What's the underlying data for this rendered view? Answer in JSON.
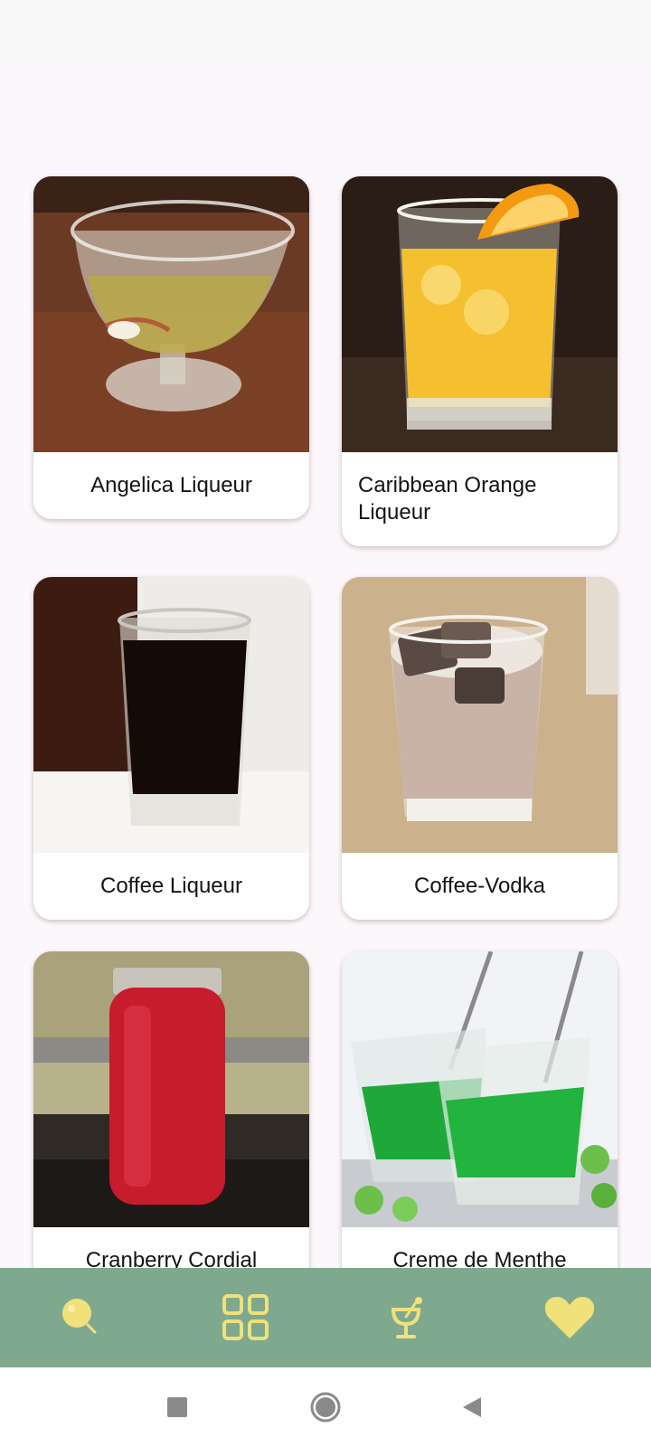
{
  "drinks": [
    {
      "name": "Angelica Liqueur"
    },
    {
      "name": "Caribbean Orange Liqueur"
    },
    {
      "name": "Coffee Liqueur"
    },
    {
      "name": "Coffee-Vodka"
    },
    {
      "name": "Cranberry Cordial"
    },
    {
      "name": "Creme de Menthe"
    }
  ],
  "bottom_nav": {
    "items": [
      {
        "icon": "search-icon"
      },
      {
        "icon": "grid-icon"
      },
      {
        "icon": "cocktail-icon"
      },
      {
        "icon": "heart-icon"
      }
    ],
    "color": "#7ea98f",
    "icon_color": "#f0e17a"
  },
  "system_nav": {
    "items": [
      {
        "icon": "recent-apps-icon"
      },
      {
        "icon": "home-icon"
      },
      {
        "icon": "back-icon"
      }
    ]
  }
}
